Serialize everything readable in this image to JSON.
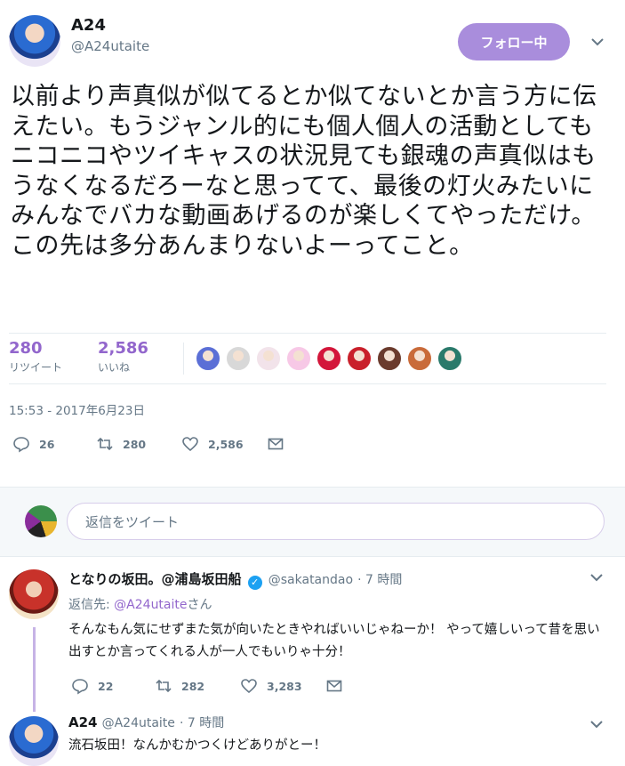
{
  "tweet": {
    "author_name": "A24",
    "author_handle": "@A24utaite",
    "follow_label": "フォロー中",
    "text": "以前より声真似が似てるとか似てないとか言う方に伝えたい。もうジャンル的にも個人個人の活動としてもニコニコやツイキャスの状況見ても銀魂の声真似はもうなくなるだろーなと思ってて、最後の灯火みたいにみんなでバカな動画あげるのが楽しくてやっただけ。この先は多分あんまりないよーってこと。",
    "retweets": "280",
    "retweets_label": "リツイート",
    "likes": "2,586",
    "likes_label": "いいね",
    "timestamp": "15:53 - 2017年6月23日",
    "action_replies": "26",
    "action_retweets": "280",
    "action_likes": "2,586"
  },
  "reply_box": {
    "placeholder": "返信をツイート"
  },
  "replies": [
    {
      "name": "となりの坂田。@浦島坂田船",
      "handle": "@sakatandao",
      "time": "· 7 時間",
      "reply_to_prefix": "返信先: ",
      "reply_to_mention": "@A24utaite",
      "reply_to_suffix": "さん",
      "text": "そんなもん気にせずまた気が向いたときやればいいじゃねーか！ やって嬉しいって昔を思い出すとか言ってくれる人が一人でもいりゃ十分！",
      "replies": "22",
      "retweets": "282",
      "likes": "3,283"
    },
    {
      "name": "A24",
      "handle": "@A24utaite",
      "time": "· 7 時間",
      "text": "流石坂田！なんかむかつくけどありがとー！"
    }
  ],
  "liker_colors": [
    "#5b6fd6",
    "#d8d8d8",
    "#f2e3ea",
    "#f7c8e6",
    "#d3163a",
    "#c9202b",
    "#6b3b2d",
    "#c96b3a",
    "#2a7a6b"
  ],
  "colors": {
    "accent": "#9266cc",
    "follow_bg": "#a98ddc",
    "muted": "#657786"
  }
}
